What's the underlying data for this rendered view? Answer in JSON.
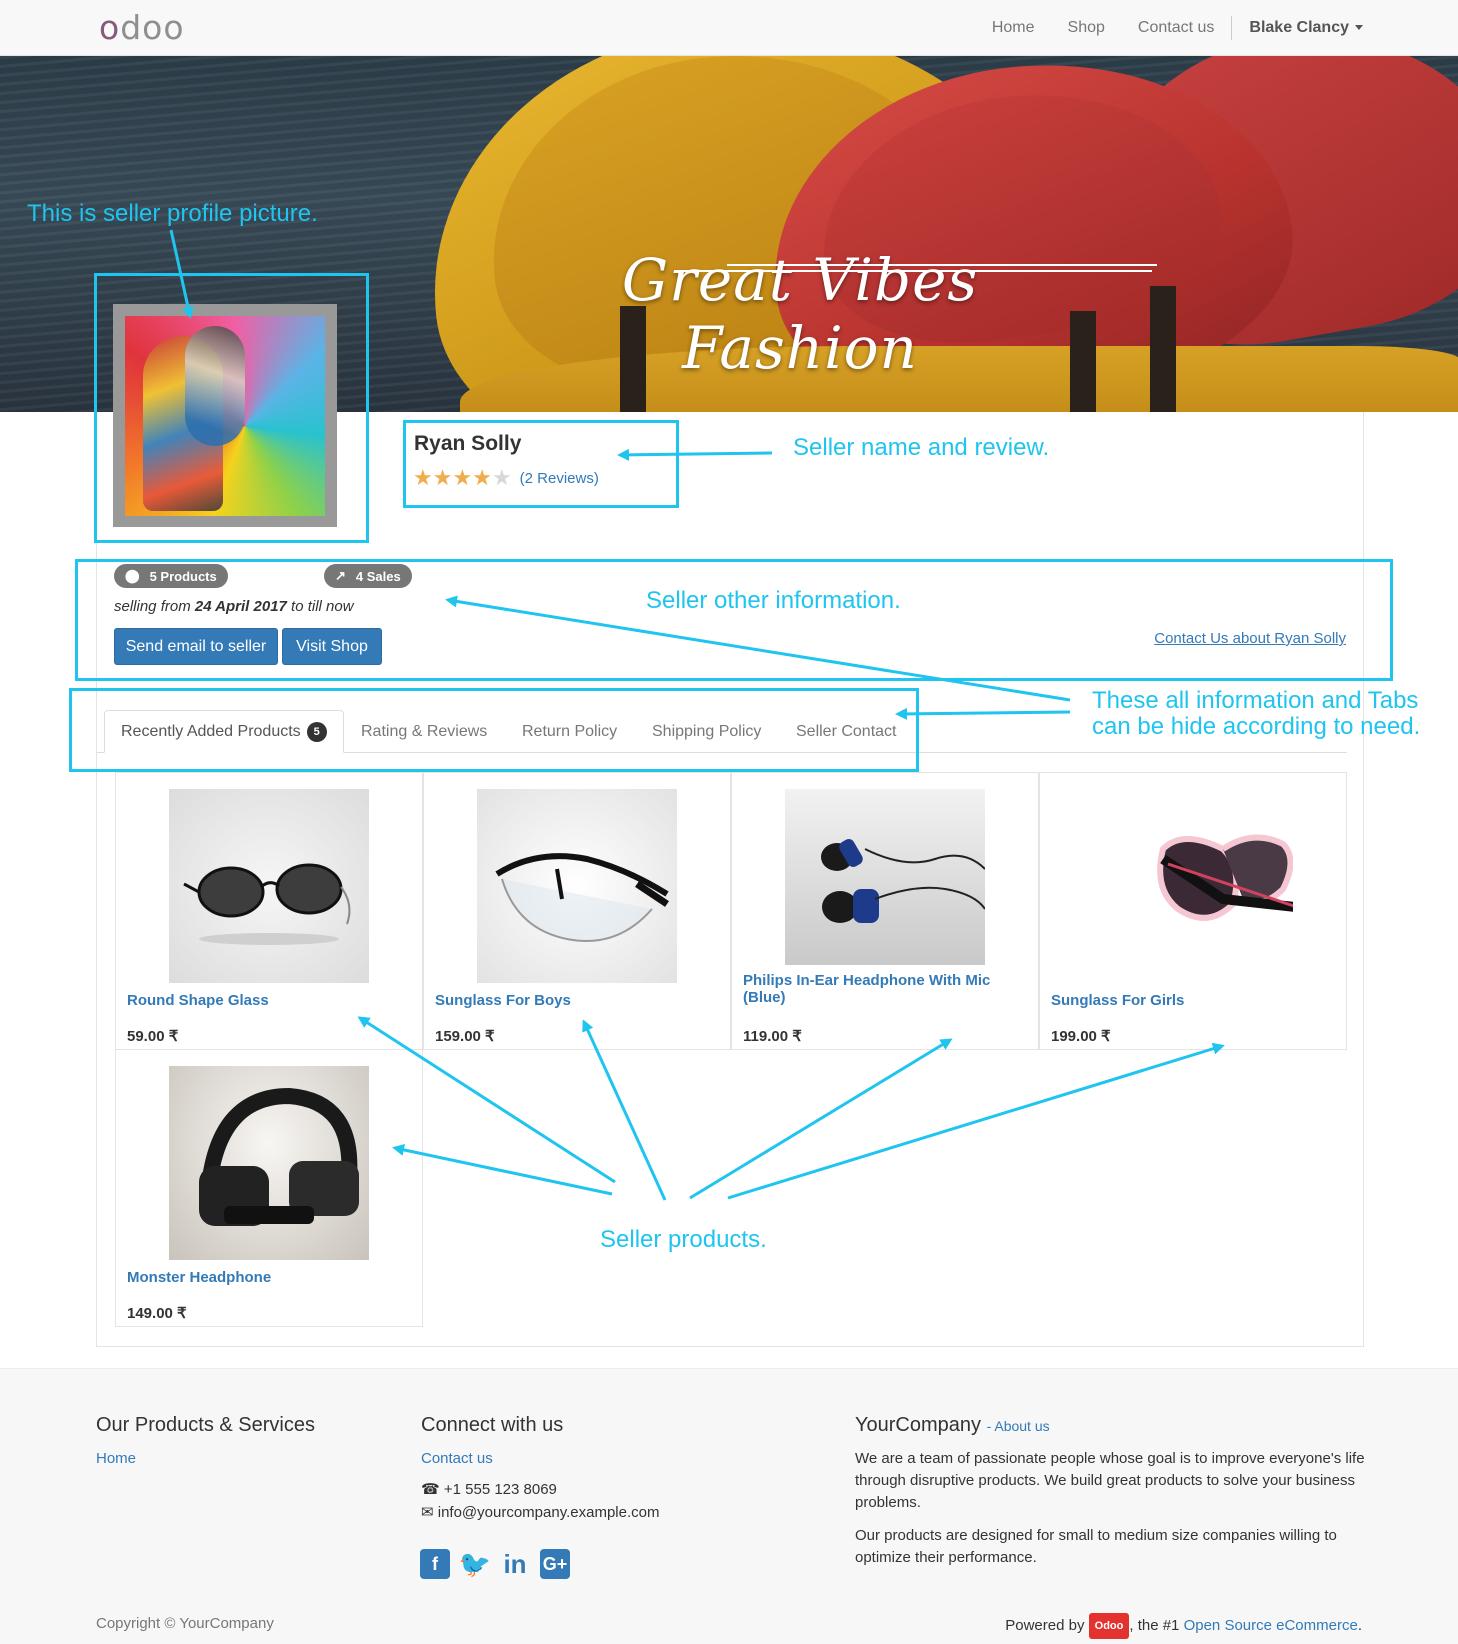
{
  "navbar": {
    "logo": "odoo",
    "links": [
      "Home",
      "Shop",
      "Contact us"
    ],
    "user": "Blake Clancy"
  },
  "banner": {
    "title": "Great Vibes Fashion"
  },
  "seller": {
    "name": "Ryan Solly",
    "rating": 4,
    "rating_max": 5,
    "reviews": "(2 Reviews)",
    "products_badge": "5 Products",
    "sales_badge": "4 Sales",
    "selling_prefix": "selling from",
    "selling_date": "24 April 2017",
    "selling_suffix": "to till now",
    "send_email": "Send email to seller",
    "visit_shop": "Visit Shop",
    "contact_about": "Contact Us about Ryan Solly"
  },
  "tabs": [
    {
      "label": "Recently Added Products",
      "count": "5"
    },
    {
      "label": "Rating & Reviews"
    },
    {
      "label": "Return Policy"
    },
    {
      "label": "Shipping Policy"
    },
    {
      "label": "Seller Contact"
    }
  ],
  "products": [
    {
      "name": "Round Shape Glass",
      "price": "59.00 ₹"
    },
    {
      "name": "Sunglass For Boys",
      "price": "159.00 ₹"
    },
    {
      "name": "Philips In-Ear Headphone With Mic (Blue)",
      "price": "119.00 ₹"
    },
    {
      "name": "Sunglass For Girls",
      "price": "199.00 ₹"
    },
    {
      "name": "Monster Headphone",
      "price": "149.00 ₹"
    }
  ],
  "annotations": {
    "profile_picture": "This is seller profile picture.",
    "name_review": "Seller name and review.",
    "other_info": "Seller other information.",
    "tabs_line1": "These all information and Tabs",
    "tabs_line2": "can be hide according to need.",
    "products": "Seller products."
  },
  "footer": {
    "col1_title": "Our Products & Services",
    "col1_link": "Home",
    "col2_title": "Connect with us",
    "col2_link": "Contact us",
    "phone": "+1 555 123 8069",
    "email": "info@yourcompany.example.com",
    "col3_title": "YourCompany",
    "col3_about": "- About us",
    "col3_p1": "We are a team of passionate people whose goal is to improve everyone's life through disruptive products. We build great products to solve your business problems.",
    "col3_p2": "Our products are designed for small to medium size companies willing to optimize their performance.",
    "copyright": "Copyright © YourCompany",
    "powered_by": "Powered by",
    "powered_badge": "Odoo",
    "powered_mid": ", the #1",
    "powered_link": "Open Source eCommerce",
    "powered_end": "."
  },
  "colors": {
    "annotation": "#1fc4ef",
    "link": "#337ab7",
    "star": "#f0ad4e",
    "badge": "#777777"
  }
}
